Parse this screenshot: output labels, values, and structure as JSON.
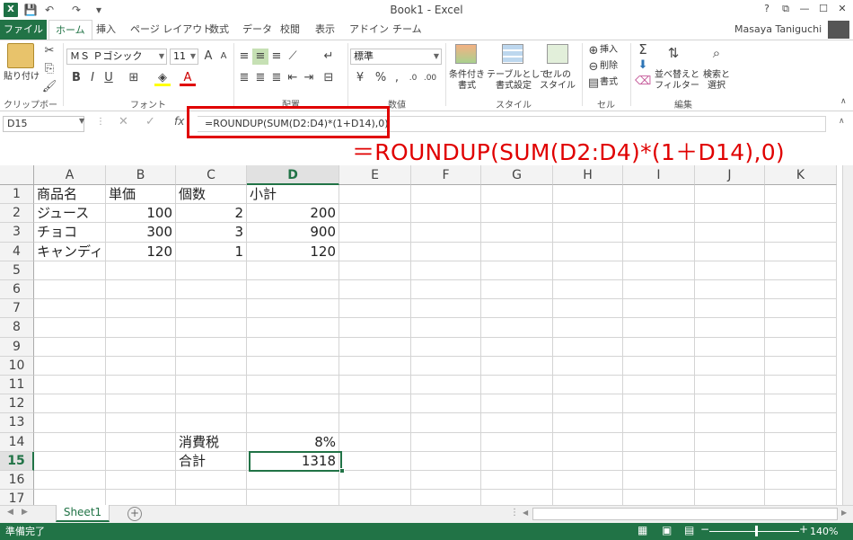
{
  "app": {
    "window_title": "Book1 - Excel",
    "logo_glyph": "X",
    "quick_access": [
      "💾",
      "↶",
      "↷",
      "▾"
    ],
    "window_buttons": [
      "?",
      "⧉",
      "—",
      "☐",
      "✕"
    ],
    "user_name": "Masaya Taniguchi"
  },
  "ribbon_tabs": [
    "ファイル",
    "ホーム",
    "挿入",
    "ページ レイアウト",
    "数式",
    "データ",
    "校閲",
    "表示",
    "アドイン",
    "チーム"
  ],
  "ribbon": {
    "clipboard": {
      "paste": "貼り付け",
      "label": "クリップボード"
    },
    "font": {
      "name": "ＭＳ Ｐゴシック",
      "size": "11",
      "label": "フォント",
      "bold": "B",
      "italic": "I",
      "underline": "U",
      "grow": "A",
      "shrink": "A"
    },
    "alignment": {
      "label": "配置"
    },
    "number": {
      "format": "標準",
      "label": "数値",
      "percent": "%",
      "comma": ","
    },
    "styles": {
      "conditional": "条件付き\n書式",
      "table": "テーブルとして\n書式設定",
      "cell": "セルの\nスタイル",
      "label": "スタイル"
    },
    "cells": {
      "insert": "挿入",
      "delete": "削除",
      "format": "書式",
      "label": "セル"
    },
    "editing": {
      "sort": "並べ替えと\nフィルター",
      "find": "検索と\n選択",
      "label": "編集",
      "sigma": "Σ"
    }
  },
  "formula_bar": {
    "name_box": "D15",
    "fx": "fx",
    "cancel": "✕",
    "enter": "✓",
    "formula": "=ROUNDUP(SUM(D2:D4)*(1+D14),0)",
    "callout": "＝ROUNDUP(SUM(D2:D4)*(1＋D14),0)"
  },
  "grid": {
    "columns": [
      "A",
      "B",
      "C",
      "D",
      "E",
      "F",
      "G",
      "H",
      "I",
      "J",
      "K"
    ],
    "rows": [
      "1",
      "2",
      "3",
      "4",
      "5",
      "6",
      "7",
      "8",
      "9",
      "10",
      "11",
      "12",
      "13",
      "14",
      "15",
      "16",
      "17"
    ],
    "cells": {
      "A1": "商品名",
      "B1": "単価",
      "C1": "個数",
      "D1": "小計",
      "A2": "ジュース",
      "B2": "100",
      "C2": "2",
      "D2": "200",
      "A3": "チョコ",
      "B3": "300",
      "C3": "3",
      "D3": "900",
      "A4": "キャンディ",
      "B4": "120",
      "C4": "1",
      "D4": "120",
      "C14": "消費税",
      "D14": "8%",
      "C15": "合計",
      "D15": "1318"
    },
    "active_cell": "D15"
  },
  "sheets": {
    "tabs": [
      "Sheet1"
    ],
    "add": "+"
  },
  "status": {
    "text": "準備完了",
    "zoom": "140%"
  },
  "colors": {
    "accent": "#217346",
    "highlight": "#e00000"
  }
}
